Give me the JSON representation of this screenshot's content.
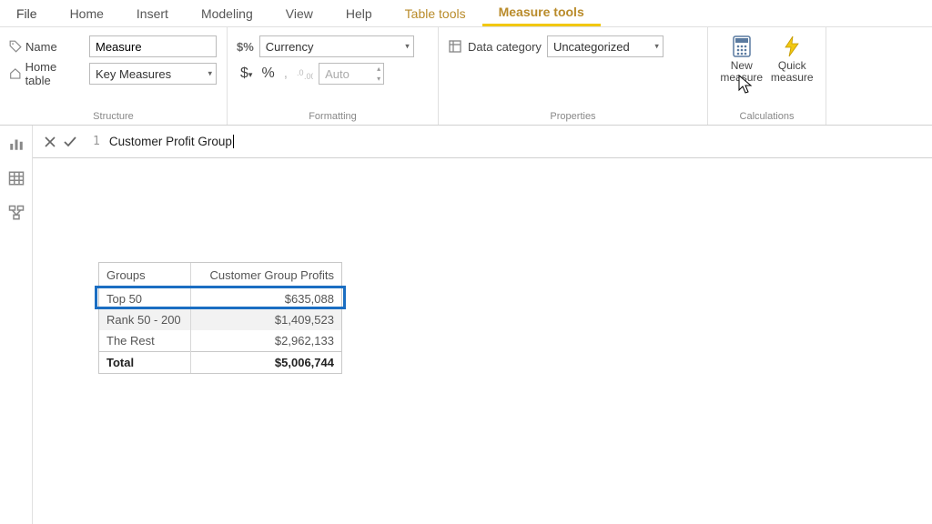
{
  "menu": {
    "file": "File",
    "home": "Home",
    "insert": "Insert",
    "modeling": "Modeling",
    "view": "View",
    "help": "Help",
    "tabletools": "Table tools",
    "measuretools": "Measure tools"
  },
  "ribbon": {
    "structure": {
      "group_label": "Structure",
      "name_label": "Name",
      "name_value": "Measure",
      "home_table_label": "Home table",
      "home_table_value": "Key Measures"
    },
    "formatting": {
      "group_label": "Formatting",
      "format_value": "Currency",
      "dollar": "$",
      "percent": "%",
      "comma": ",",
      "decimals_value": "Auto"
    },
    "properties": {
      "group_label": "Properties",
      "data_category_label": "Data category",
      "data_category_value": "Uncategorized"
    },
    "calculations": {
      "group_label": "Calculations",
      "new_measure": "New measure",
      "quick_measure": "Quick measure"
    }
  },
  "formula": {
    "line": "1",
    "text": "Customer Profit Group"
  },
  "table": {
    "header": {
      "c1": "Groups",
      "c2": "Customer Group Profits"
    },
    "rows": [
      {
        "c1": "Top 50",
        "c2": "$635,088"
      },
      {
        "c1": "Rank 50 - 200",
        "c2": "$1,409,523"
      },
      {
        "c1": "The Rest",
        "c2": "$2,962,133"
      }
    ],
    "total": {
      "c1": "Total",
      "c2": "$5,006,744"
    }
  },
  "chart_data": {
    "type": "table",
    "title": "Customer Group Profits",
    "columns": [
      "Groups",
      "Customer Group Profits"
    ],
    "rows": [
      [
        "Top 50",
        635088
      ],
      [
        "Rank 50 - 200",
        1409523
      ],
      [
        "The Rest",
        2962133
      ]
    ],
    "total": [
      "Total",
      5006744
    ],
    "currency": "USD"
  }
}
